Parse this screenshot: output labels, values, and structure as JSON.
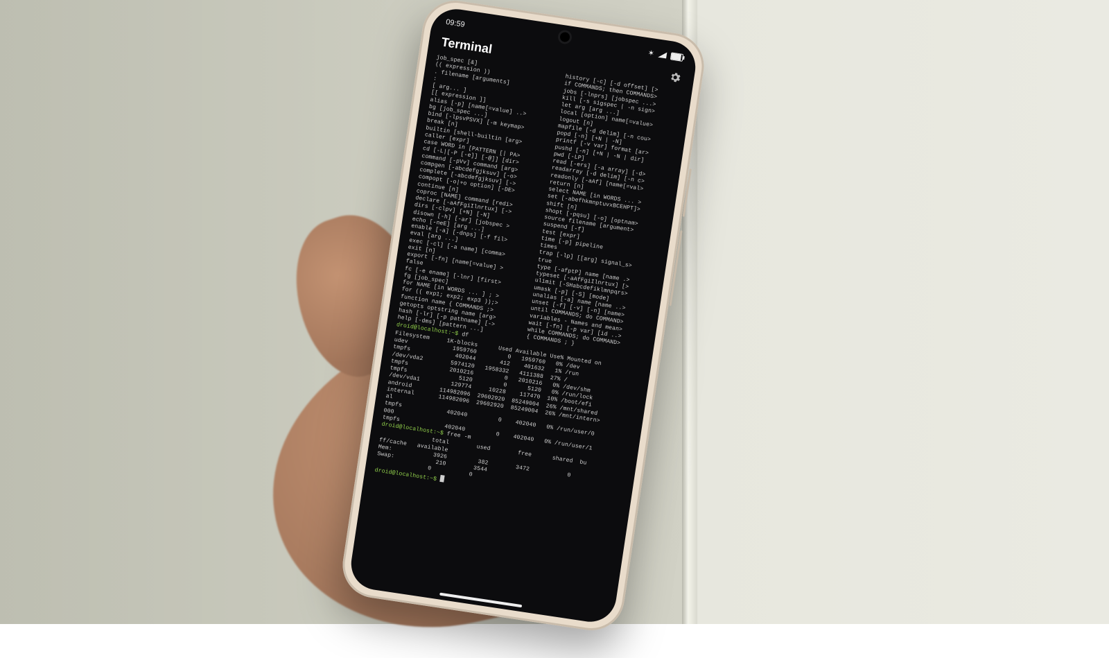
{
  "statusbar": {
    "time": "09:59"
  },
  "app": {
    "title": "Terminal"
  },
  "help": {
    "left": [
      "job_spec [&]",
      "(( expression ))",
      ". filename [arguments]",
      ":",
      "[ arg... ]",
      "[[ expression ]]",
      "alias [-p] [name[=value] ..>",
      "bg [job_spec ...]",
      "bind [-lpsvPSVX] [-m keymap>",
      "break [n]",
      "builtin [shell-builtin [arg>",
      "caller [expr]",
      "case WORD in [PATTERN [| PA>",
      "cd [-L|[-P [-e]] [-@]] [dir>",
      "command [-pVv] command [arg>",
      "compgen [-abcdefgjksuv] [-o>",
      "complete [-abcdefgjksuv] [->",
      "compopt [-o|+o option] [-DE>",
      "continue [n]",
      "coproc [NAME] command [redi>",
      "declare [-aAfFgiIlnrtux] [->",
      "dirs [-clpv] [+N] [-N]",
      "disown [-h] [-ar] [jobspec >",
      "echo [-neE] [arg ...]",
      "enable [-a] [-dnps] [-f fil>",
      "eval [arg ...]",
      "exec [-cl] [-a name] [comma>",
      "exit [n]",
      "export [-fn] [name[=value] >",
      "false",
      "fc [-e ename] [-lnr] [first>",
      "fg [job_spec]",
      "for NAME [in WORDS ... ] ; >",
      "for (( exp1; exp2; exp3 ));>",
      "function name { COMMANDS ;>",
      "getopts optstring name [arg>",
      "hash [-lr] [-p pathname] [->",
      "help [-dms] [pattern ...]"
    ],
    "right": [
      "history [-c] [-d offset] [>",
      "if COMMANDS; then COMMANDS>",
      "jobs [-lnprs] [jobspec ...>",
      "kill [-s sigspec | -n sign>",
      "let arg [arg ...]",
      "local [option] name[=value>",
      "logout [n]",
      "mapfile [-d delim] [-n cou>",
      "popd [-n] [+N | -N]",
      "printf [-v var] format [ar>",
      "pushd [-n] [+N | -N | dir]",
      "pwd [-LP]",
      "read [-ers] [-a array] [-d>",
      "readarray [-d delim] [-n c>",
      "readonly [-aAf] [name[=val>",
      "return [n]",
      "select NAME [in WORDS ... >",
      "set [-abefhkmnptuvxBCEHPT]>",
      "shift [n]",
      "shopt [-pqsu] [-o] [optnam>",
      "source filename [argument>",
      "suspend [-f]",
      "test [expr]",
      "time [-p] pipeline",
      "times",
      "trap [-lp] [[arg] signal_s>",
      "true",
      "type [-afptP] name [name .>",
      "typeset [-aAfFgiIlnrtux] [>",
      "ulimit [-SHabcdefiklmnpqrs>",
      "umask [-p] [-S] [mode]",
      "unalias [-a] name [name ..>",
      "unset [-f] [-v] [-n] [name>",
      "until COMMANDS; do COMMAND>",
      "variables - Names and mean>",
      "wait [-fn] [-p var] [id ..>",
      "while COMMANDS; do COMMAND>",
      "{ COMMANDS ; }"
    ]
  },
  "session": {
    "prompt": "droid@localhost",
    "pwd": "~",
    "cmd1": "df",
    "cmd2": "free -m",
    "cmd3": ""
  },
  "df": {
    "header": "Filesystem     1K-blocks      Used Available Use% Mounted on",
    "rows": [
      "udev             1959760         0   1959760   0% /dev",
      "tmpfs             402044       412    401632   1% /run",
      "/dev/vda2        5974120   1958332   4111388  27% /",
      "tmpfs            2010216         0   2010216   0% /dev/shm",
      "tmpfs               5120         0      5120   0% /run/lock",
      "/dev/vda1         129774     10228    117470  10% /boot/efi",
      "android        114982096  29602920  85249004  26% /mnt/shared",
      "internal       114982096  29602920  85249004  26% /mnt/intern>",
      "al",
      "tmpfs             402040         0    402040   0% /run/user/0",
      "000",
      "tmpfs             402040         0    402040   0% /run/user/1"
    ]
  },
  "free": {
    "header": "               total        used        free      shared  bu",
    "rows": [
      "ff/cache   available",
      "Mem:            3926         382        3472           0",
      "Swap:            210        3544",
      "               0           0"
    ]
  }
}
